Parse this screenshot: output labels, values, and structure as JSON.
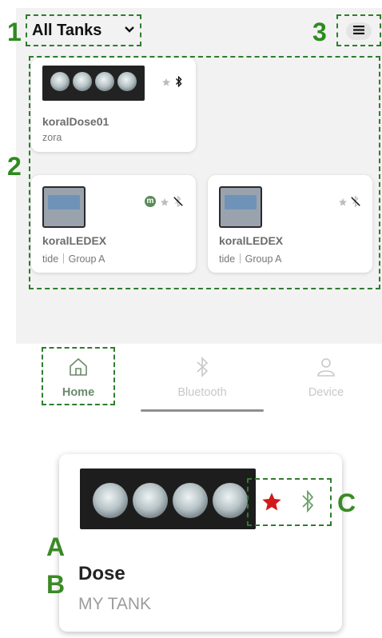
{
  "header": {
    "tank_selector_label": "All Tanks",
    "chevron_icon": "chevron-down-icon",
    "menu_icon": "hamburger-menu-icon"
  },
  "annotations": {
    "n1": "1",
    "n2": "2",
    "n3": "3",
    "la": "A",
    "lb": "B",
    "lc": "C"
  },
  "devices": [
    {
      "name": "koralDose01",
      "subtitle": "zora",
      "type": "dose",
      "favorite": false,
      "bluetooth": "connected"
    },
    {
      "name": "koralLEDEX",
      "subtitle": "tide｜Group A",
      "type": "led",
      "badge": "m",
      "favorite": false,
      "bluetooth": "disconnected"
    },
    {
      "name": "koralLEDEX",
      "subtitle": "tide｜Group A",
      "type": "led",
      "favorite": false,
      "bluetooth": "disconnected"
    }
  ],
  "nav": {
    "home": "Home",
    "bluetooth": "Bluetooth",
    "device": "Device",
    "active": "home"
  },
  "zoom_card": {
    "title": "Dose",
    "subtitle": "MY TANK",
    "favorite": true,
    "bluetooth": "connected"
  },
  "colors": {
    "accent_green": "#2e8b1f",
    "nav_active": "#6a8a6a",
    "nav_inactive": "#c8c8c8",
    "favorite_red": "#d11a1a",
    "badge_green": "#5a8a5a"
  }
}
